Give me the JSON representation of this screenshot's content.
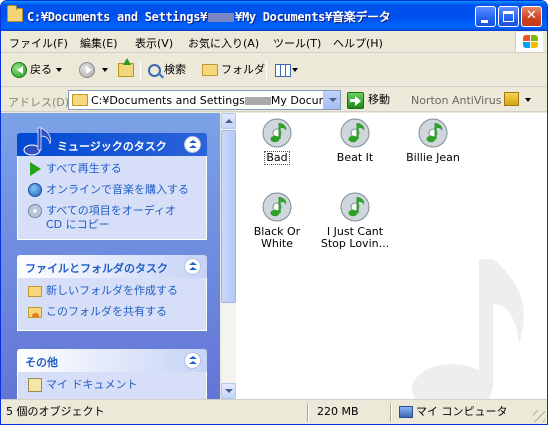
{
  "window": {
    "title_prefix": "C:¥Documents and Settings¥",
    "title_suffix": "¥My Documents¥音楽データ"
  },
  "menu": [
    "ファイル(F)",
    "編集(E)",
    "表示(V)",
    "お気に入り(A)",
    "ツール(T)",
    "ヘルプ(H)"
  ],
  "toolbar": {
    "back": "戻る",
    "search": "検索",
    "folders": "フォルダ"
  },
  "address": {
    "label": "アドレス(D)",
    "value_prefix": "C:¥Documents and Settings",
    "value_suffix": "My Docum",
    "go": "移動",
    "norton": "Norton AntiVirus"
  },
  "taskpane": {
    "music_tasks": {
      "title": "ミュージックのタスク",
      "items": [
        "すべて再生する",
        "オンラインで音楽を購入する",
        "すべての項目をオーディオ",
        "CD にコピー"
      ]
    },
    "file_tasks": {
      "title": "ファイルとフォルダのタスク",
      "items": [
        "新しいフォルダを作成する",
        "このフォルダを共有する"
      ]
    },
    "other": {
      "title": "その他",
      "items": [
        "マイ ドキュメント"
      ]
    }
  },
  "files": [
    {
      "name": "Bad",
      "selected": true
    },
    {
      "name": "Beat It",
      "selected": false
    },
    {
      "name": "Billie Jean",
      "selected": false
    },
    {
      "name": "Black Or White",
      "selected": false
    },
    {
      "name": "I Just Cant Stop Lovin...",
      "selected": false
    }
  ],
  "status": {
    "objects": "5 個のオブジェクト",
    "size": "220 MB",
    "location": "マイ コンピュータ"
  },
  "colors": {
    "titlebar": "#0050ee",
    "taskpane": "#7ba2e7",
    "task_link": "#215dc6"
  },
  "icons": {
    "file": "music-note-cd-icon",
    "play": "play-icon",
    "buy": "globe-icon",
    "copy": "cd-icon"
  }
}
